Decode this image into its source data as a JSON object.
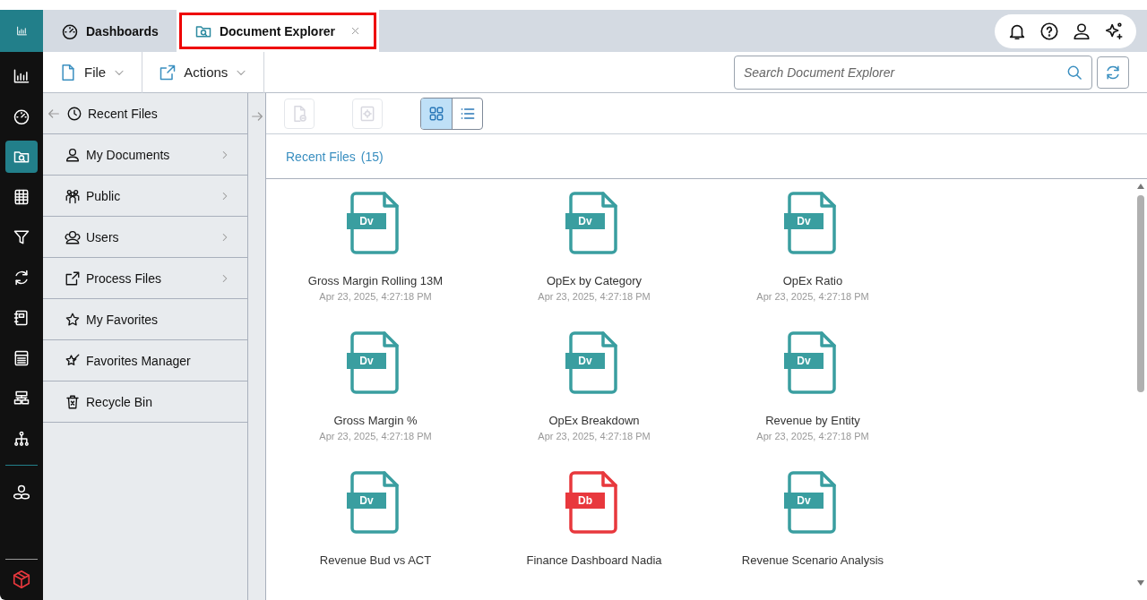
{
  "rail": {
    "main_items": [
      {
        "kind": "chart",
        "selected": false
      },
      {
        "kind": "gauge",
        "selected": false
      },
      {
        "kind": "folder-search",
        "selected": true
      },
      {
        "kind": "spreadsheet",
        "selected": false
      },
      {
        "kind": "filter",
        "selected": false
      },
      {
        "kind": "sync",
        "selected": false
      },
      {
        "kind": "notebook",
        "selected": false
      },
      {
        "kind": "report",
        "selected": false
      },
      {
        "kind": "flow",
        "selected": false
      },
      {
        "kind": "hierarchy",
        "selected": false
      }
    ],
    "extra_items": [
      {
        "kind": "cluster",
        "selected": false
      }
    ]
  },
  "tabs": [
    {
      "label": "Dashboards",
      "kind": "gauge",
      "selected": false,
      "closable": false,
      "highlighted": false
    },
    {
      "label": "Document Explorer",
      "kind": "folder-search",
      "selected": true,
      "closable": true,
      "highlighted": true
    }
  ],
  "toolbar": {
    "menus": [
      {
        "label": "File",
        "kind": "file"
      },
      {
        "label": "Actions",
        "kind": "export"
      }
    ],
    "search": {
      "placeholder": "Search Document Explorer"
    }
  },
  "sidebar": {
    "header": {
      "label": "Recent Files",
      "kind": "clock"
    },
    "items": [
      {
        "label": "My Documents",
        "kind": "person",
        "expandable": true
      },
      {
        "label": "Public",
        "kind": "people",
        "expandable": true
      },
      {
        "label": "Users",
        "kind": "users",
        "expandable": true
      },
      {
        "label": "Process Files",
        "kind": "export",
        "expandable": true
      },
      {
        "label": "My Favorites",
        "kind": "star",
        "expandable": false
      },
      {
        "label": "Favorites Manager",
        "kind": "star-edit",
        "expandable": false
      },
      {
        "label": "Recycle Bin",
        "kind": "trash",
        "expandable": false
      }
    ]
  },
  "content": {
    "tools": [
      {
        "kind": "remove-file",
        "disabled": true
      },
      {
        "kind": "settings",
        "disabled": true
      }
    ],
    "views": [
      {
        "kind": "grid",
        "selected": true
      },
      {
        "kind": "list",
        "selected": false
      }
    ],
    "title": "Recent Files",
    "count": "(15)",
    "files": [
      {
        "name": "Gross Margin Rolling 13M",
        "date": "Apr 23, 2025, 4:27:18 PM",
        "type": "Dv",
        "color": "#3a9ea0"
      },
      {
        "name": "OpEx by Category",
        "date": "Apr 23, 2025, 4:27:18 PM",
        "type": "Dv",
        "color": "#3a9ea0"
      },
      {
        "name": "OpEx Ratio",
        "date": "Apr 23, 2025, 4:27:18 PM",
        "type": "Dv",
        "color": "#3a9ea0"
      },
      {
        "name": "Gross Margin %",
        "date": "Apr 23, 2025, 4:27:18 PM",
        "type": "Dv",
        "color": "#3a9ea0"
      },
      {
        "name": "OpEx Breakdown",
        "date": "Apr 23, 2025, 4:27:18 PM",
        "type": "Dv",
        "color": "#3a9ea0"
      },
      {
        "name": "Revenue by Entity",
        "date": "Apr 23, 2025, 4:27:18 PM",
        "type": "Dv",
        "color": "#3a9ea0"
      },
      {
        "name": "Revenue Bud vs ACT",
        "type": "Dv",
        "color": "#3a9ea0"
      },
      {
        "name": "Finance Dashboard Nadia",
        "type": "Db",
        "color": "#e8383d"
      },
      {
        "name": "Revenue Scenario Analysis",
        "type": "Dv",
        "color": "#3a9ea0"
      }
    ]
  }
}
